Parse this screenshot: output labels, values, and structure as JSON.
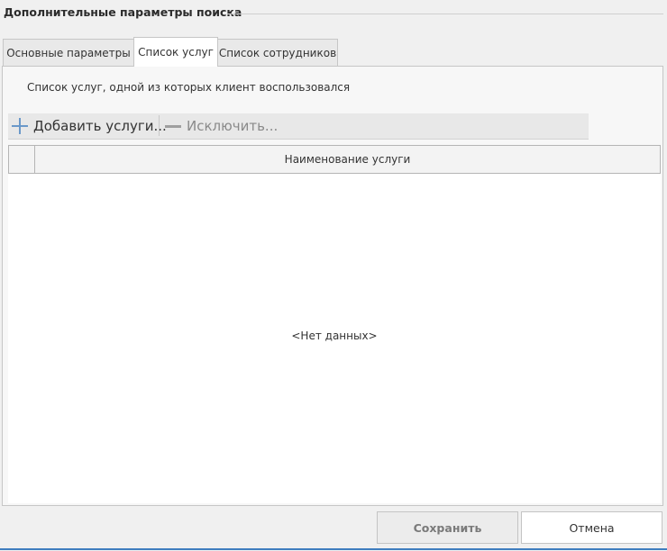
{
  "group": {
    "title": "Дополнительные параметры поиска"
  },
  "tabs": [
    {
      "label": "Основные параметры",
      "active": false
    },
    {
      "label": "Список услуг",
      "active": true
    },
    {
      "label": "Список сотрудников",
      "active": false
    }
  ],
  "panel": {
    "caption": "Список услуг, одной из которых клиент воспользовался"
  },
  "toolbar": {
    "add_label": "Добавить услуги...",
    "add_icon": "plus-icon",
    "remove_label": "Исключить...",
    "remove_icon": "minus-icon"
  },
  "grid": {
    "columns": [
      "Наименование услуги"
    ],
    "empty_text": "<Нет данных>"
  },
  "footer": {
    "save_label": "Сохранить",
    "cancel_label": "Отмена"
  },
  "colors": {
    "accent": "#3f7dbf",
    "plus_icon": "#6a98c9"
  }
}
